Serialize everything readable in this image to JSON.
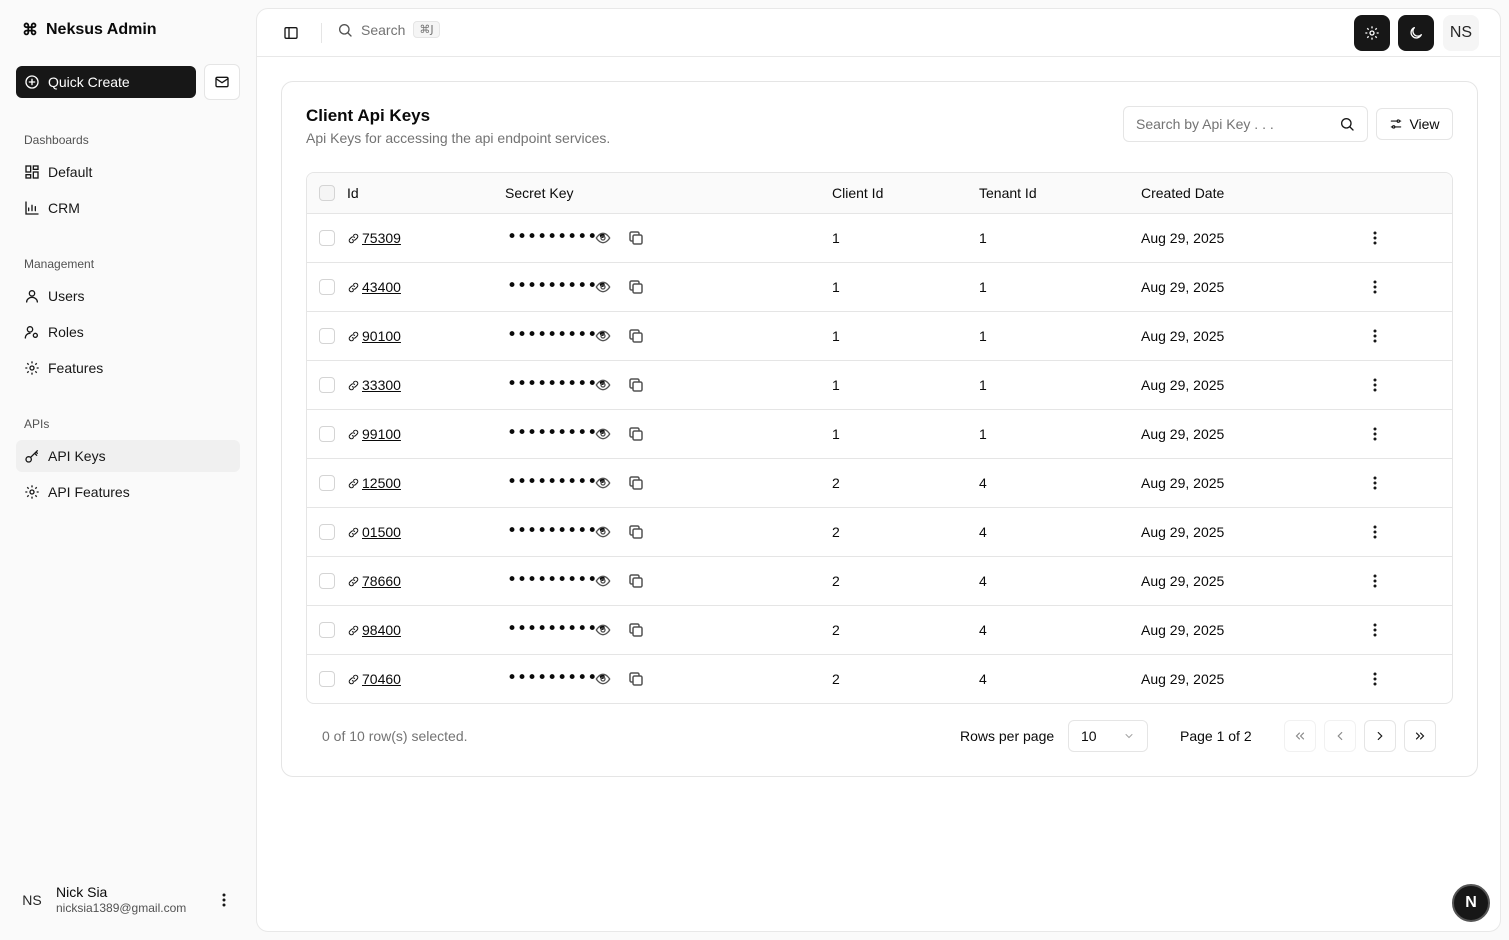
{
  "app": {
    "title": "Neksus Admin"
  },
  "sidebar": {
    "quick_create": "Quick Create",
    "groups": [
      {
        "label": "Dashboards",
        "items": [
          {
            "label": "Default",
            "icon": "dashboard-icon"
          },
          {
            "label": "CRM",
            "icon": "chart-icon"
          }
        ]
      },
      {
        "label": "Management",
        "items": [
          {
            "label": "Users",
            "icon": "user-icon"
          },
          {
            "label": "Roles",
            "icon": "user-key-icon"
          },
          {
            "label": "Features",
            "icon": "gear-icon"
          }
        ]
      },
      {
        "label": "APIs",
        "items": [
          {
            "label": "API Keys",
            "icon": "key-icon",
            "active": true
          },
          {
            "label": "API Features",
            "icon": "gear-icon"
          }
        ]
      }
    ],
    "user": {
      "initials": "NS",
      "name": "Nick Sia",
      "email": "nicksia1389@gmail.com"
    }
  },
  "topbar": {
    "search_label": "Search",
    "shortcut": "⌘J",
    "avatar": "NS"
  },
  "card": {
    "title": "Client Api Keys",
    "description": "Api Keys for accessing the api endpoint services.",
    "search_placeholder": "Search by Api Key . . .",
    "view_label": "View"
  },
  "table": {
    "headers": {
      "id": "Id",
      "secret": "Secret Key",
      "client": "Client Id",
      "tenant": "Tenant Id",
      "created": "Created Date"
    },
    "rows": [
      {
        "id": "75309",
        "secret": "••••••••••",
        "client": "1",
        "tenant": "1",
        "created": "Aug 29, 2025"
      },
      {
        "id": "43400",
        "secret": "••••••••••",
        "client": "1",
        "tenant": "1",
        "created": "Aug 29, 2025"
      },
      {
        "id": "90100",
        "secret": "••••••••••",
        "client": "1",
        "tenant": "1",
        "created": "Aug 29, 2025"
      },
      {
        "id": "33300",
        "secret": "••••••••••",
        "client": "1",
        "tenant": "1",
        "created": "Aug 29, 2025"
      },
      {
        "id": "99100",
        "secret": "••••••••••",
        "client": "1",
        "tenant": "1",
        "created": "Aug 29, 2025"
      },
      {
        "id": "12500",
        "secret": "••••••••••",
        "client": "2",
        "tenant": "4",
        "created": "Aug 29, 2025"
      },
      {
        "id": "01500",
        "secret": "••••••••••",
        "client": "2",
        "tenant": "4",
        "created": "Aug 29, 2025"
      },
      {
        "id": "78660",
        "secret": "••••••••••",
        "client": "2",
        "tenant": "4",
        "created": "Aug 29, 2025"
      },
      {
        "id": "98400",
        "secret": "••••••••••",
        "client": "2",
        "tenant": "4",
        "created": "Aug 29, 2025"
      },
      {
        "id": "70460",
        "secret": "••••••••••",
        "client": "2",
        "tenant": "4",
        "created": "Aug 29, 2025"
      }
    ]
  },
  "pagination": {
    "selected_text": "0 of 10 row(s) selected.",
    "rows_per_page_label": "Rows per page",
    "rows_per_page": "10",
    "page_info": "Page 1 of 2"
  },
  "fab": {
    "label": "N"
  }
}
